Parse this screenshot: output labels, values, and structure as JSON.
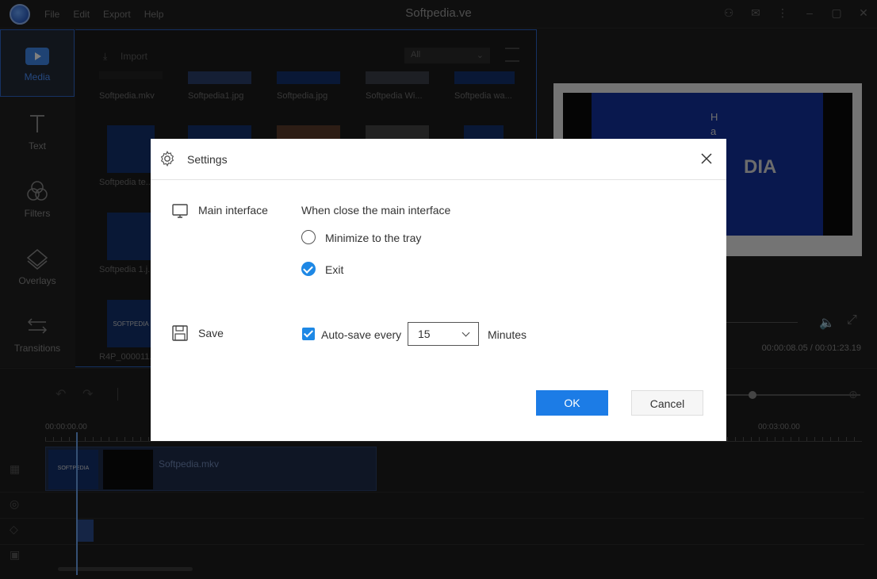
{
  "app": {
    "title": "Softpedia.ve",
    "menu": [
      "File",
      "Edit",
      "Export",
      "Help"
    ]
  },
  "sidebar": {
    "items": [
      {
        "label": "Media",
        "icon": "media-icon",
        "active": true
      },
      {
        "label": "Text",
        "icon": "text-icon"
      },
      {
        "label": "Filters",
        "icon": "filters-icon"
      },
      {
        "label": "Overlays",
        "icon": "overlays-icon"
      },
      {
        "label": "Transitions",
        "icon": "transitions-icon"
      }
    ]
  },
  "library": {
    "import_label": "Import",
    "filter_value": "All",
    "row1": [
      "Softpedia.mkv",
      "Softpedia1.jpg",
      "Softpedia.jpg",
      "Softpedia Wi...",
      "Softpedia wa..."
    ],
    "row2_first": "Softpedia te...",
    "row3_first": "Softpedia 1.j...",
    "row4_first": "R4P_000011...",
    "thumb_watermark": "SOFTPEDIA"
  },
  "preview": {
    "time": "00:00:08.05 / 00:01:23.19",
    "overlay_letters": [
      "H",
      "a"
    ],
    "brand_fragment": "DIA"
  },
  "timeline": {
    "start_time": "00:00:00.00",
    "mark_time": "00:03:00.00",
    "clip_name": "Softpedia.mkv",
    "clip_brand": "SOFTPEDIA"
  },
  "dialog": {
    "title": "Settings",
    "section_main": "Main interface",
    "close_prompt": "When close the main interface",
    "option_minimize": "Minimize to the tray",
    "option_exit": "Exit",
    "selected_option": "Exit",
    "section_save": "Save",
    "autosave_label": "Auto-save every",
    "autosave_checked": true,
    "autosave_value": "15",
    "autosave_unit": "Minutes",
    "ok_label": "OK",
    "cancel_label": "Cancel"
  },
  "colors": {
    "accent": "#1c7ce6",
    "sidebar_active": "#4a90ff",
    "background": "#1c1c1c"
  }
}
